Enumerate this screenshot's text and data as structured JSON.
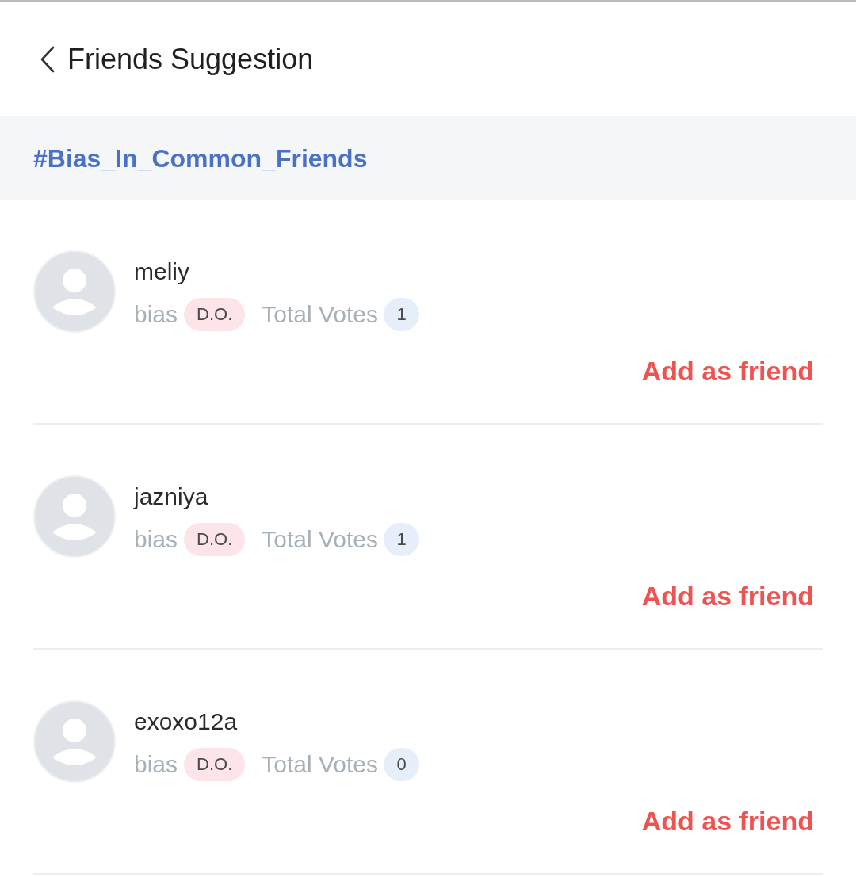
{
  "header": {
    "title": "Friends Suggestion"
  },
  "section": {
    "heading": "#Bias_In_Common_Friends"
  },
  "friends": [
    {
      "name": "meliy",
      "bias_label": "bias",
      "bias": "D.O.",
      "votes_label": "Total Votes",
      "votes": "1",
      "action": "Add as friend"
    },
    {
      "name": "jazniya",
      "bias_label": "bias",
      "bias": "D.O.",
      "votes_label": "Total Votes",
      "votes": "1",
      "action": "Add as friend"
    },
    {
      "name": "exoxo12a",
      "bias_label": "bias",
      "bias": "D.O.",
      "votes_label": "Total Votes",
      "votes": "0",
      "action": "Add as friend"
    }
  ]
}
